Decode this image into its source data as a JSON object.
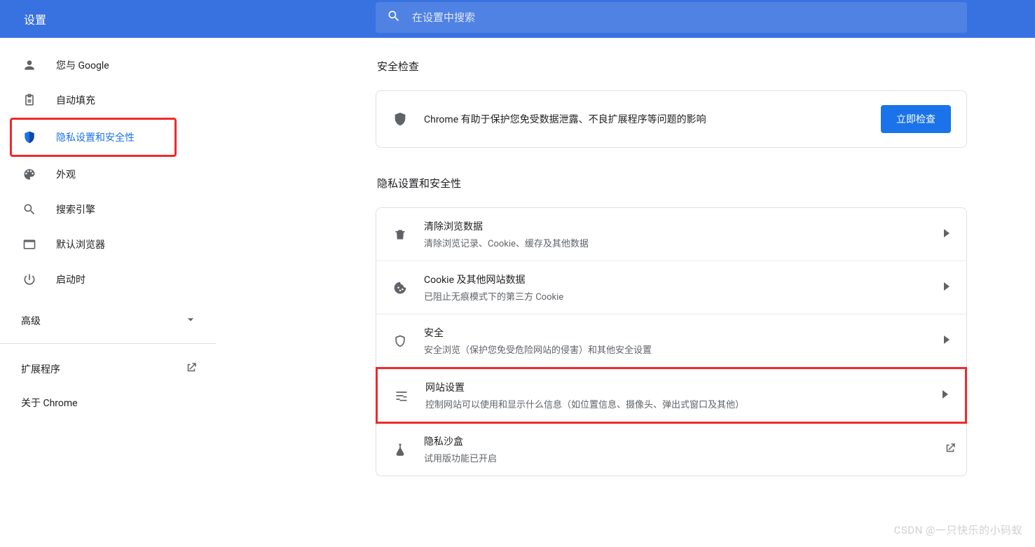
{
  "header": {
    "title": "设置",
    "search_placeholder": "在设置中搜索"
  },
  "sidebar": {
    "items": [
      {
        "label": "您与 Google"
      },
      {
        "label": "自动填充"
      },
      {
        "label": "隐私设置和安全性"
      },
      {
        "label": "外观"
      },
      {
        "label": "搜索引擎"
      },
      {
        "label": "默认浏览器"
      },
      {
        "label": "启动时"
      }
    ],
    "advanced_label": "高级",
    "extensions_label": "扩展程序",
    "about_label": "关于 Chrome"
  },
  "main": {
    "section1_title": "安全检查",
    "safety_text": "Chrome 有助于保护您免受数据泄露、不良扩展程序等问题的影响",
    "safety_button": "立即检查",
    "section2_title": "隐私设置和安全性",
    "rows": [
      {
        "title": "清除浏览数据",
        "sub": "清除浏览记录、Cookie、缓存及其他数据"
      },
      {
        "title": "Cookie 及其他网站数据",
        "sub": "已阻止无痕模式下的第三方 Cookie"
      },
      {
        "title": "安全",
        "sub": "安全浏览（保护您免受危险网站的侵害）和其他安全设置"
      },
      {
        "title": "网站设置",
        "sub": "控制网站可以使用和显示什么信息（如位置信息、摄像头、弹出式窗口及其他）"
      },
      {
        "title": "隐私沙盒",
        "sub": "试用版功能已开启"
      }
    ]
  },
  "watermark": "CSDN @一只快乐的小码蚁"
}
